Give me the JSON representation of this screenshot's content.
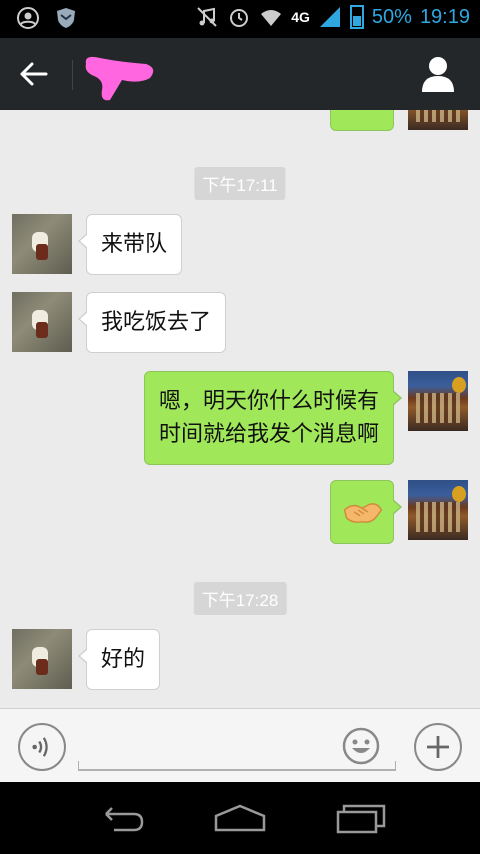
{
  "status_bar": {
    "network": "4G",
    "battery": "50%",
    "time": "19:19",
    "icons": [
      "account-circle-icon",
      "shield-icon",
      "music-mute-icon",
      "alarm-icon",
      "wifi-icon",
      "signal-icon",
      "battery-icon"
    ]
  },
  "header": {
    "back_icon": "arrow-left-icon",
    "title_redaction_color": "#ff66e0",
    "profile_icon": "person-icon"
  },
  "chat": {
    "timestamps": [
      "下午17:11",
      "下午17:28"
    ],
    "messages": [
      {
        "from": "friend",
        "text": "来带队"
      },
      {
        "from": "friend",
        "text": "我吃饭去了"
      },
      {
        "from": "me",
        "line1": "嗯，明天你什么时候有",
        "line2": "时间就给我发个消息啊"
      },
      {
        "from": "me",
        "emoji": "handshake-emoji"
      },
      {
        "from": "friend",
        "text": "好的"
      }
    ]
  },
  "input_bar": {
    "voice_icon": "voice-icon",
    "emoji_icon": "smiley-icon",
    "plus_icon": "plus-icon",
    "text_value": ""
  },
  "nav_bar": {
    "back": "back-nav-icon",
    "home": "home-nav-icon",
    "recents": "recents-nav-icon"
  },
  "colors": {
    "header_bg": "#232729",
    "chat_bg": "#ebebeb",
    "my_bubble": "#a0e75a",
    "friend_bubble": "#ffffff",
    "status_accent": "#2fa7e0"
  }
}
